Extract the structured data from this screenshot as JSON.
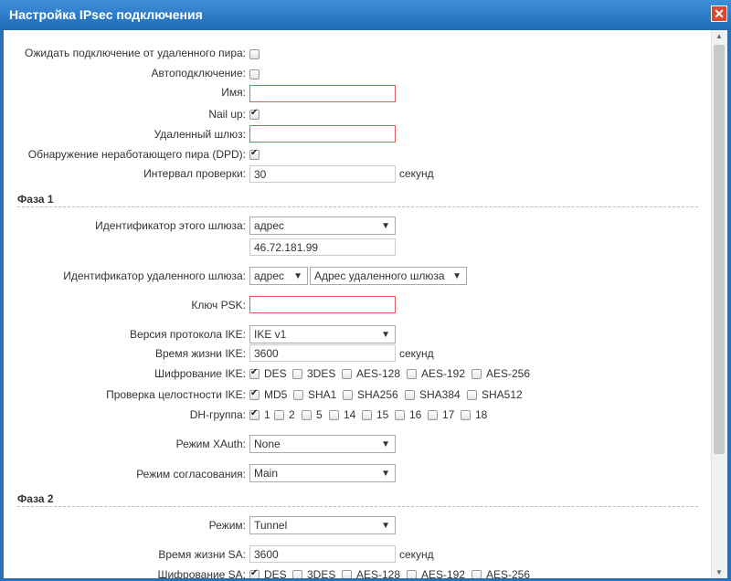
{
  "window": {
    "title": "Настройка IPsec подключения"
  },
  "fields": {
    "wait_peer": {
      "label": "Ожидать подключение от удаленного пира:"
    },
    "auto_connect": {
      "label": "Автоподключение:"
    },
    "name": {
      "label": "Имя:",
      "value": ""
    },
    "nail_up": {
      "label": "Nail up:"
    },
    "remote_gateway": {
      "label": "Удаленный шлюз:",
      "value": ""
    },
    "dpd": {
      "label": "Обнаружение неработающего пира (DPD):"
    },
    "check_interval": {
      "label": "Интервал проверки:",
      "value": "30",
      "unit": "секунд"
    }
  },
  "phase1": {
    "title": "Фаза 1",
    "local_id": {
      "label": "Идентификатор этого шлюза:",
      "type": "адрес",
      "value": "46.72.181.99"
    },
    "remote_id": {
      "label": "Идентификатор удаленного шлюза:",
      "type": "адрес",
      "target": "Адрес удаленного шлюза"
    },
    "psk": {
      "label": "Ключ PSK:",
      "value": ""
    },
    "ike_version": {
      "label": "Версия протокола IKE:",
      "value": "IKE v1"
    },
    "ike_lifetime": {
      "label": "Время жизни IKE:",
      "value": "3600",
      "unit": "секунд"
    },
    "ike_encryption": {
      "label": "Шифрование IKE:",
      "options": [
        "DES",
        "3DES",
        "AES-128",
        "AES-192",
        "AES-256"
      ]
    },
    "ike_integrity": {
      "label": "Проверка целостности IKE:",
      "options": [
        "MD5",
        "SHA1",
        "SHA256",
        "SHA384",
        "SHA512"
      ]
    },
    "dh_group": {
      "label": "DH-группа:",
      "options": [
        "1",
        "2",
        "5",
        "14",
        "15",
        "16",
        "17",
        "18"
      ]
    },
    "xauth": {
      "label": "Режим XAuth:",
      "value": "None"
    },
    "negotiation": {
      "label": "Режим согласования:",
      "value": "Main"
    }
  },
  "phase2": {
    "title": "Фаза 2",
    "mode": {
      "label": "Режим:",
      "value": "Tunnel"
    },
    "sa_lifetime": {
      "label": "Время жизни SA:",
      "value": "3600",
      "unit": "секунд"
    },
    "sa_encryption": {
      "label": "Шифрование SA:",
      "options": [
        "DES",
        "3DES",
        "AES-128",
        "AES-192",
        "AES-256"
      ]
    }
  },
  "icons": {
    "close": "✕",
    "dropdown": "▼",
    "scroll_up": "▲",
    "scroll_down": "▼"
  },
  "colors": {
    "title_bar": "#2b6fb5",
    "close_button": "#d9482f",
    "required_border": "#e05a5a"
  }
}
